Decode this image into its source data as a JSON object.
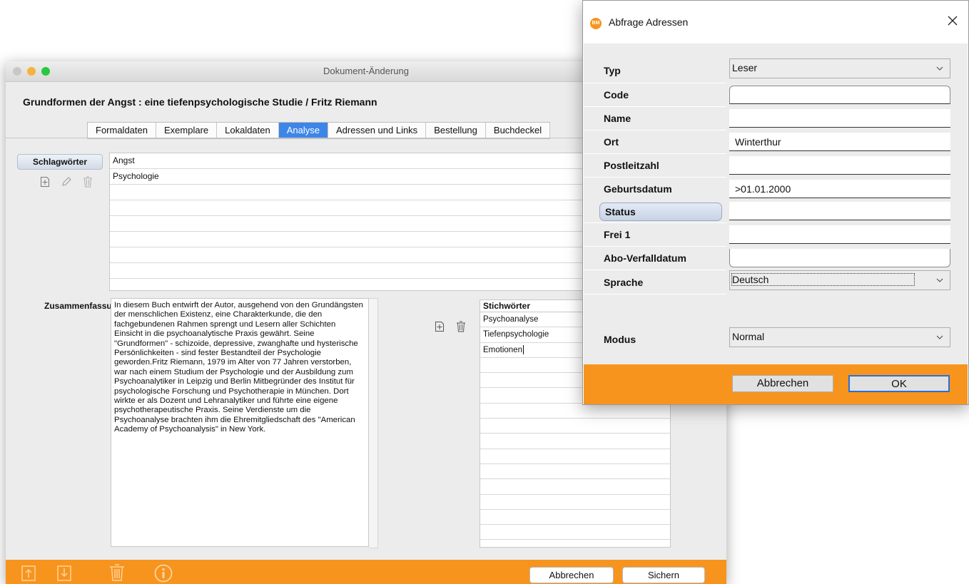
{
  "main_window": {
    "title": "Dokument-Änderung",
    "document_title": "Grundformen der Angst : eine tiefenpsychologische Studie / Fritz Riemann",
    "tabs": [
      {
        "label": "Formaldaten",
        "active": false
      },
      {
        "label": "Exemplare",
        "active": false
      },
      {
        "label": "Lokaldaten",
        "active": false
      },
      {
        "label": "Analyse",
        "active": true
      },
      {
        "label": "Adressen und Links",
        "active": false
      },
      {
        "label": "Bestellung",
        "active": false
      },
      {
        "label": "Buchdeckel",
        "active": false
      }
    ],
    "schlagwoerter": {
      "label": "Schlagwörter",
      "items": [
        "Angst",
        "Psychologie",
        "",
        "",
        "",
        "",
        "",
        "",
        ""
      ]
    },
    "zusammenfassung": {
      "label": "Zusammenfassu",
      "text": "In diesem Buch entwirft der Autor, ausgehend von den Grundängsten der menschlichen Existenz, eine Charakterkunde, die den fachgebundenen Rahmen sprengt und Lesern aller Schichten Einsicht in die psychoanalytische Praxis gewährt. Seine \"Grundformen\" - schizoide, depressive, zwanghafte und hysterische Persönlichkeiten - sind fester Bestandteil der Psychologie geworden.Fritz Riemann, 1979 im Alter von 77 Jahren verstorben, war nach einem Studium der Psychologie und der Ausbildung zum Psychoanalytiker in Leipzig und Berlin Mitbegründer des Institut für psychologische Forschung und Psychotherapie in München. Dort wirkte er als Dozent und Lehranalytiker und führte eine eigene psychotherapeutische Praxis. Seine Verdienste um die Psychoanalyse brachten ihm die Ehremitgliedschaft des \"American Academy of Psychoanalysis\" in New York."
    },
    "stichwoerter": {
      "header": "Stichwörter",
      "items": [
        "Psychoanalyse",
        "Tiefenpsychologie",
        "Emotionen",
        "",
        "",
        "",
        "",
        "",
        "",
        "",
        "",
        "",
        "",
        "",
        ""
      ]
    },
    "buttons": {
      "cancel": "Abbrechen",
      "save": "Sichern"
    }
  },
  "dialog": {
    "logo": "BM",
    "title": "Abfrage Adressen",
    "fields": [
      {
        "label": "Typ",
        "kind": "select",
        "value": "Leser"
      },
      {
        "label": "Code",
        "kind": "input",
        "value": ""
      },
      {
        "label": "Name",
        "kind": "input",
        "value": ""
      },
      {
        "label": "Ort",
        "kind": "input",
        "value": "Winterthur"
      },
      {
        "label": "Postleitzahl",
        "kind": "input",
        "value": ""
      },
      {
        "label": "Geburtsdatum",
        "kind": "input",
        "value": ">01.01.2000"
      },
      {
        "label": "Status",
        "kind": "input",
        "value": "",
        "highlighted": true
      },
      {
        "label": "Frei 1",
        "kind": "input",
        "value": ""
      },
      {
        "label": "Abo-Verfalldatum",
        "kind": "input",
        "value": ""
      },
      {
        "label": "Sprache",
        "kind": "select",
        "value": "Deutsch"
      }
    ],
    "modus": {
      "label": "Modus",
      "value": "Normal"
    },
    "buttons": {
      "cancel": "Abbrechen",
      "ok": "OK"
    },
    "colors": {
      "accent": "#f7941e"
    }
  }
}
